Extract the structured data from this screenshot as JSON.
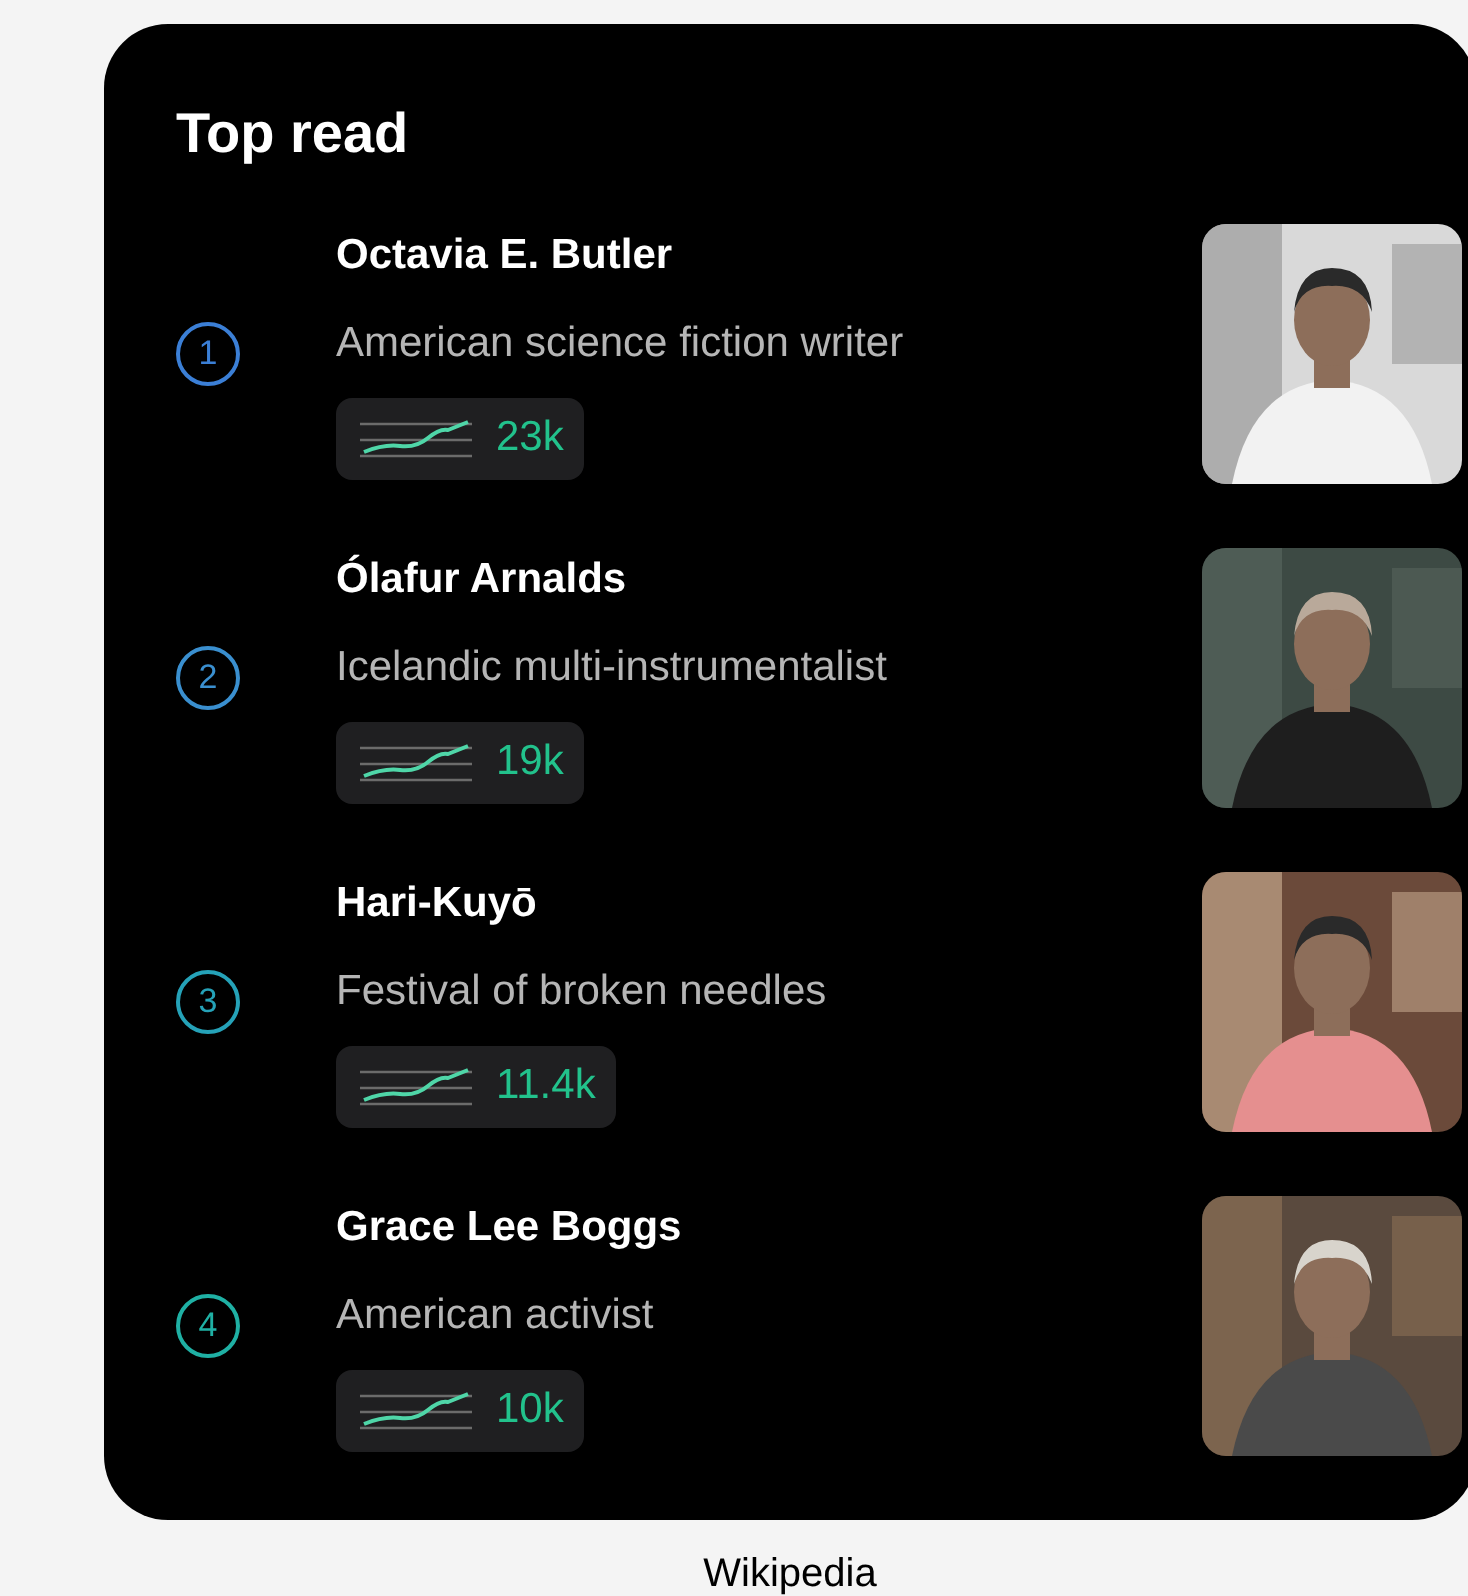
{
  "title": "Top read",
  "items": [
    {
      "rank": "1",
      "color": "#3b7fd6",
      "name": "Octavia E. Butler",
      "description": "American science fiction writer",
      "views": "23k"
    },
    {
      "rank": "2",
      "color": "#3a8fcf",
      "name": "Ólafur Arnalds",
      "description": "Icelandic multi-instrumentalist",
      "views": "19k"
    },
    {
      "rank": "3",
      "color": "#25a2b8",
      "name": "Hari-Kuyō",
      "description": "Festival of broken needles",
      "views": "11.4k"
    },
    {
      "rank": "4",
      "color": "#1fb0a4",
      "name": "Grace Lee Boggs",
      "description": "American activist",
      "views": "10k"
    }
  ],
  "caption": "Wikipedia"
}
